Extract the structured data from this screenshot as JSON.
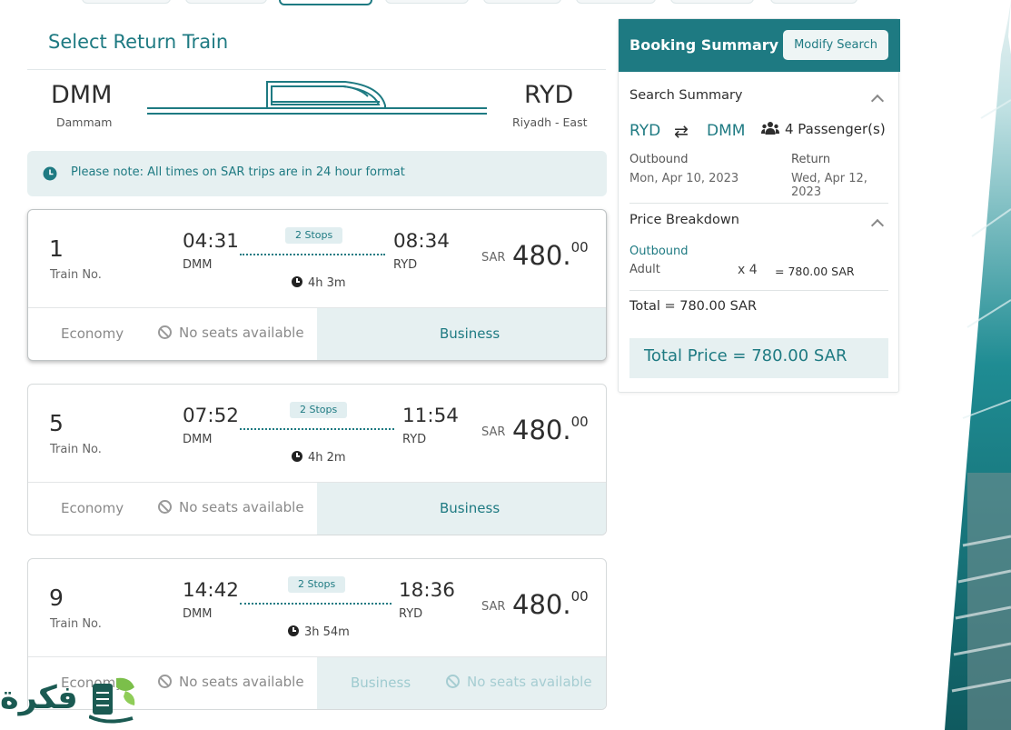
{
  "page": {
    "heading": "Select Return Train"
  },
  "route": {
    "from_code": "DMM",
    "from_name": "Dammam",
    "to_code": "RYD",
    "to_name": "Riyadh - East"
  },
  "notice": {
    "text": "Please note: All times on SAR trips are in 24 hour format",
    "icon": "clock-icon"
  },
  "labels": {
    "train_no": "Train No.",
    "currency": "SAR",
    "economy": "Economy",
    "business": "Business",
    "no_seats": "No seats available"
  },
  "trains": [
    {
      "number": "1",
      "depart_time": "04:31",
      "depart_code": "DMM",
      "arrive_time": "08:34",
      "arrive_code": "RYD",
      "stops": "2 Stops",
      "duration": "4h 3m",
      "price_main": "480.",
      "price_dec": "00",
      "business_available": true
    },
    {
      "number": "5",
      "depart_time": "07:52",
      "depart_code": "DMM",
      "arrive_time": "11:54",
      "arrive_code": "RYD",
      "stops": "2 Stops",
      "duration": "4h 2m",
      "price_main": "480.",
      "price_dec": "00",
      "business_available": true
    },
    {
      "number": "9",
      "depart_time": "14:42",
      "depart_code": "DMM",
      "arrive_time": "18:36",
      "arrive_code": "RYD",
      "stops": "2 Stops",
      "duration": "3h 54m",
      "price_main": "480.",
      "price_dec": "00",
      "business_available": false
    }
  ],
  "summary": {
    "title": "Booking Summary",
    "modify_label": "Modify Search",
    "search_title": "Search Summary",
    "from": "RYD",
    "to": "DMM",
    "passengers": "4 Passenger(s)",
    "outbound_label": "Outbound",
    "outbound_date": "Mon, Apr 10, 2023",
    "return_label": "Return",
    "return_date": "Wed, Apr 12, 2023",
    "price_title": "Price Breakdown",
    "price_outbound": "Outbound",
    "adult_label": "Adult",
    "adult_qty": "x   4",
    "adult_total": "=  780.00 SAR",
    "total_line": "Total = 780.00 SAR",
    "total_price": "Total Price = 780.00 SAR"
  },
  "watermark": {
    "text": "فكرة"
  },
  "colors": {
    "accent": "#1e7a82",
    "accent_light": "#e6f0f1"
  }
}
